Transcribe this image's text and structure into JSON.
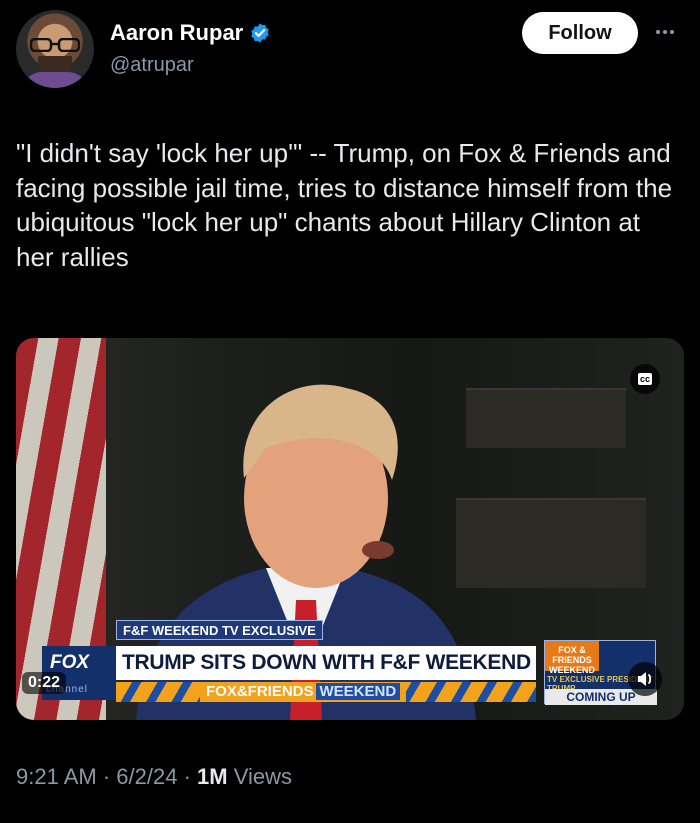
{
  "author": {
    "name": "Aaron Rupar",
    "handle": "@atrupar",
    "verified": true
  },
  "follow_label": "Follow",
  "tweet_text": "\"I didn't say 'lock her up'\" -- Trump, on Fox & Friends and facing possible jail time, tries to distance himself from the ubiquitous \"lock her up\" chants about Hillary Clinton at her rallies",
  "video": {
    "cc_label": "cc",
    "timer": "0:22",
    "chyron": {
      "exclusive_tag": "F&F WEEKEND TV EXCLUSIVE",
      "headline": "TRUMP SITS DOWN WITH F&F WEEKEND",
      "logo": "FOX",
      "logo_channel": "channel",
      "strip_brand": "FOX&FRIENDS",
      "strip_weekend": "WEEKEND",
      "promo_top": "FOX & FRIENDS WEEKEND",
      "promo_mid": "TV EXCLUSIVE PRESIDENT TRUMP",
      "promo_bottom": "COMING UP"
    }
  },
  "meta": {
    "time": "9:21 AM",
    "date": "6/2/24",
    "views_count": "1M",
    "views_label": "Views"
  },
  "colors": {
    "background": "#000000",
    "verified_blue": "#1d9bf0",
    "muted_text": "#8b98a5",
    "fox_navy": "#14306b",
    "fox_orange": "#f2a21b"
  }
}
